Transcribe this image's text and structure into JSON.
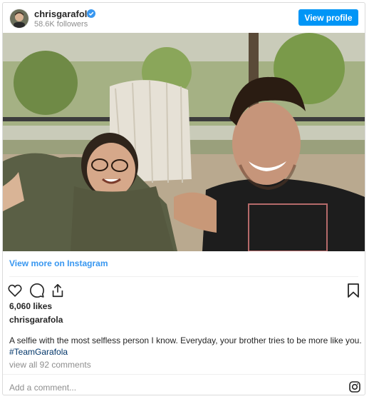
{
  "header": {
    "username": "chrisgarafola",
    "followers": "58.6K followers",
    "view_profile": "View profile",
    "verified_icon": "verified-badge-icon"
  },
  "post": {
    "image_alt": "photo",
    "view_more": "View more on Instagram",
    "likes": "6,060 likes",
    "caption_user": "chrisgarafola",
    "caption_text": "A selfie with the most selfless person I know. Everyday, your brother tries to be more like you.",
    "hashtag": "#TeamGarafola",
    "comments": "view all 92 comments"
  },
  "footer": {
    "add_comment_placeholder": "Add a comment...",
    "instagram_icon": "instagram-icon"
  },
  "icons": {
    "like": "heart-icon",
    "comment": "comment-icon",
    "share": "share-icon",
    "save": "bookmark-icon"
  },
  "colors": {
    "button": "#0095f6",
    "link": "#3897f0"
  }
}
